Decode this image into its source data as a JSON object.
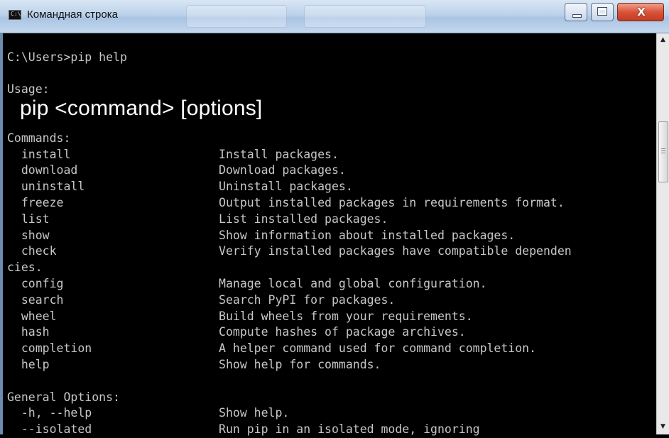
{
  "window": {
    "title": "Командная строка",
    "icon_label": "C:\\",
    "close_glyph": "X"
  },
  "console": {
    "lines": [
      "",
      "C:\\Users>pip help",
      "",
      "Usage:",
      "",
      "",
      "Commands:",
      "  install                     Install packages.",
      "  download                    Download packages.",
      "  uninstall                   Uninstall packages.",
      "  freeze                      Output installed packages in requirements format.",
      "  list                        List installed packages.",
      "  show                        Show information about installed packages.",
      "  check                       Verify installed packages have compatible dependen",
      "cies.",
      "  config                      Manage local and global configuration.",
      "  search                      Search PyPI for packages.",
      "  wheel                       Build wheels from your requirements.",
      "  hash                        Compute hashes of package archives.",
      "  completion                  A helper command used for command completion.",
      "  help                        Show help for commands.",
      "",
      "General Options:",
      "  -h, --help                  Show help.",
      "  --isolated                  Run pip in an isolated mode, ignoring"
    ],
    "usage_overlay": "pip  <command>  [options]"
  },
  "colors": {
    "console_bg": "#000000",
    "console_text": "#c7c7c7",
    "overlay_text": "#ffffff",
    "titlebar": "#bcd2ea",
    "close_button": "#c23b24"
  },
  "icons": [
    "cmd-app-icon",
    "minimize-icon",
    "maximize-icon",
    "close-icon",
    "scroll-up-arrow-icon",
    "scroll-down-arrow-icon"
  ]
}
